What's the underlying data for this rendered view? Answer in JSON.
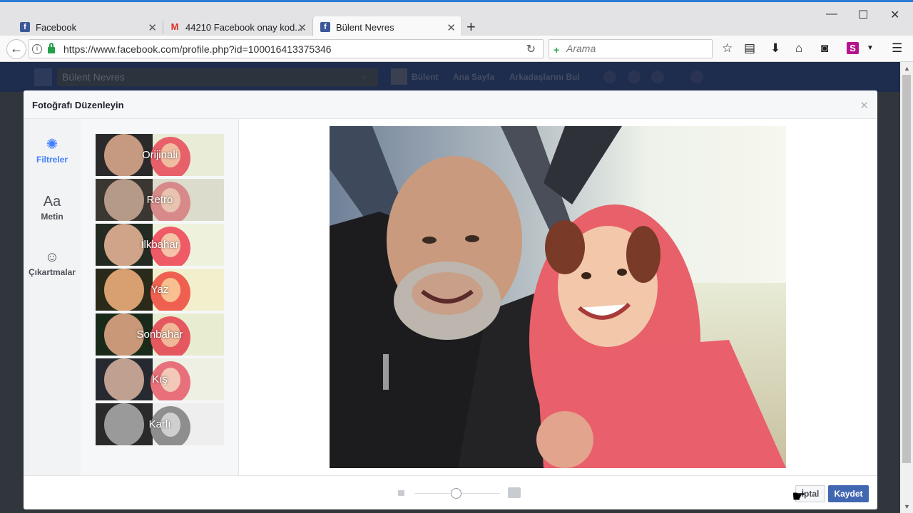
{
  "browser": {
    "tabs": [
      {
        "title": "Facebook",
        "favicon": "facebook-icon"
      },
      {
        "title": "44210 Facebook onay kod...",
        "favicon": "gmail-icon"
      },
      {
        "title": "Bülent Nevres",
        "favicon": "facebook-icon"
      }
    ],
    "url": "https://www.facebook.com/profile.php?id=100016413375346",
    "search_placeholder": "Arama",
    "addon_badge": "S"
  },
  "facebook": {
    "search_value": "Bülent Nevres",
    "nav": {
      "profile": "Bülent",
      "home": "Ana Sayfa",
      "find_friends": "Arkadaşlarını Bul"
    }
  },
  "dialog": {
    "title": "Fotoğrafı Düzenleyin",
    "tools": [
      {
        "label": "Filtreler",
        "icon": "aperture-icon",
        "icon_text": "✺"
      },
      {
        "label": "Metin",
        "icon": "text-icon",
        "icon_text": "Aa"
      },
      {
        "label": "Çıkartmalar",
        "icon": "smiley-icon",
        "icon_text": "☺"
      }
    ],
    "filters": [
      {
        "label": "Orijinali",
        "selected": true
      },
      {
        "label": "Retro"
      },
      {
        "label": "İlkbahar"
      },
      {
        "label": "Yaz"
      },
      {
        "label": "Sonbahar"
      },
      {
        "label": "Kış"
      },
      {
        "label": "Karlı"
      }
    ],
    "zoom_level": 0.5,
    "cancel_label": "İptal",
    "save_label": "Kaydet"
  },
  "colors": {
    "accent": "#4080ff",
    "primary_button": "#4267b2",
    "hoodie": "#e8606a"
  }
}
